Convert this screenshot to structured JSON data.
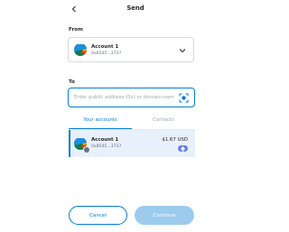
{
  "header": {
    "title": "Send",
    "back_icon": "chevron-left-icon"
  },
  "from": {
    "label": "From",
    "account_name": "Account 1",
    "account_address": "0x8545...3737",
    "dropdown_icon": "chevron-down-icon"
  },
  "to": {
    "label": "To",
    "value": "",
    "placeholder": "Enter public address (0x) or domain nam",
    "scan_icon": "qr-scan-icon"
  },
  "tabs": {
    "your_accounts": "Your accounts",
    "contacts": "Contacts",
    "active": "your_accounts"
  },
  "accounts": [
    {
      "name": "Account 1",
      "address": "0x8545...3737",
      "balance": "$1.67 USD",
      "network_badge": "eth-icon"
    }
  ],
  "footer": {
    "cancel_label": "Cancel",
    "continue_label": "Continue"
  },
  "colors": {
    "accent": "#037dd6",
    "text": "#24272a",
    "muted": "#6a737d",
    "selected_row": "#e8f1fb",
    "continue_disabled": "#9ccbee"
  }
}
